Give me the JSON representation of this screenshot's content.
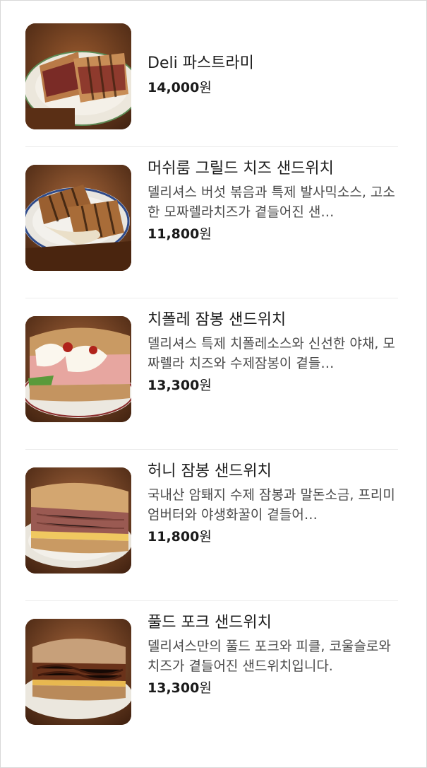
{
  "menu": {
    "items": [
      {
        "name": "Deli 파스트라미",
        "description": "",
        "price": "14,000",
        "unit": "원",
        "image_icon": "pastrami-sandwich-photo"
      },
      {
        "name": "머쉬룸 그릴드 치즈 샌드위치",
        "description": "델리셔스 버섯 볶음과 특제 발사믹소스, 고소한 모짜렐라치즈가 곁들어진 샌…",
        "price": "11,800",
        "unit": "원",
        "image_icon": "mushroom-grilled-cheese-photo"
      },
      {
        "name": "치폴레 잠봉 샌드위치",
        "description": "델리셔스 특제 치폴레소스와 신선한 야채, 모짜렐라 치즈와 수제잠봉이 곁들…",
        "price": "13,300",
        "unit": "원",
        "image_icon": "chipotle-jambon-photo"
      },
      {
        "name": "허니 잠봉 샌드위치",
        "description": "국내산 암퇘지 수제 잠봉과 말돈소금, 프리미엄버터와 야생화꿀이 곁들어…",
        "price": "11,800",
        "unit": "원",
        "image_icon": "honey-jambon-photo"
      },
      {
        "name": "풀드 포크 샌드위치",
        "description": "델리셔스만의 풀드 포크와 피클, 코울슬로와 치즈가 곁들어진 샌드위치입니다.",
        "price": "13,300",
        "unit": "원",
        "image_icon": "pulled-pork-photo"
      }
    ]
  }
}
